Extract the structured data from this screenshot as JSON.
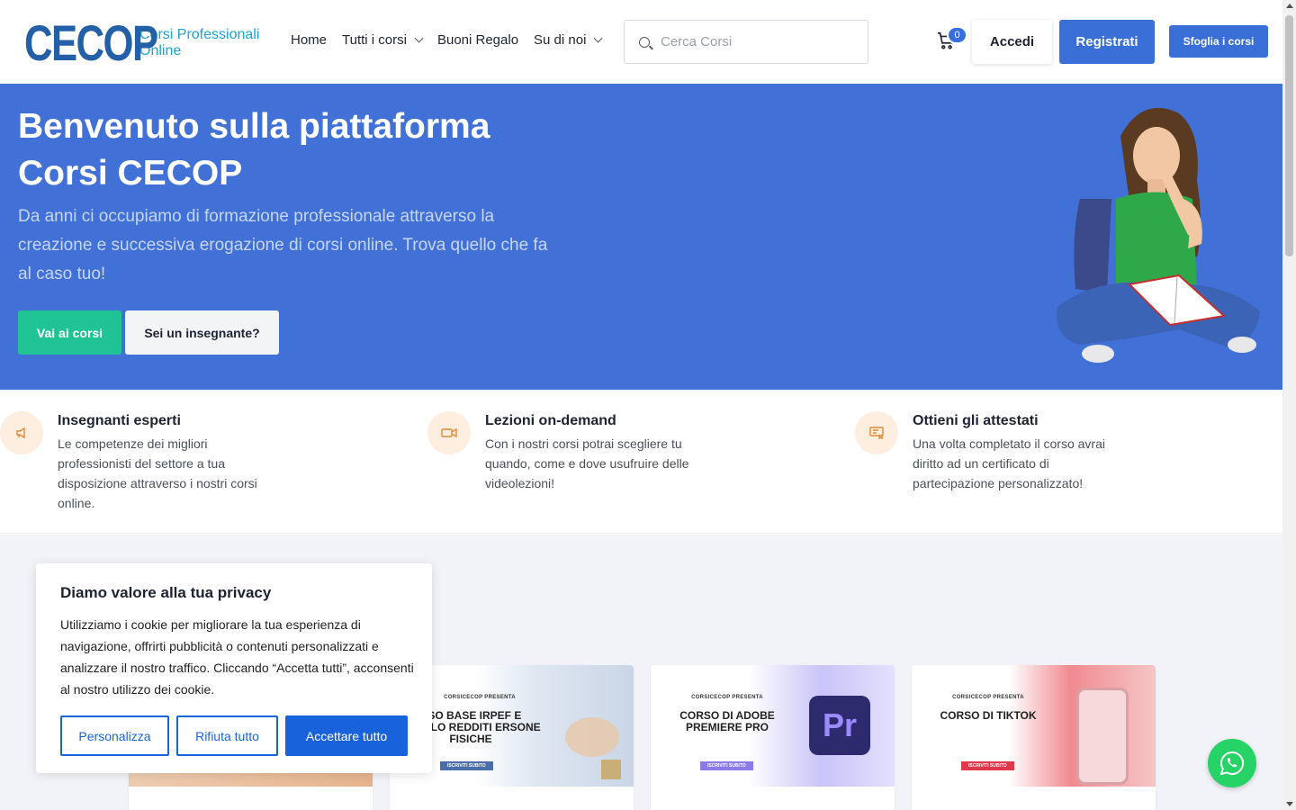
{
  "header": {
    "logo_mark": "CECOP",
    "logo_sub_line1": "Corsi Professionali",
    "logo_sub_line2": "Online",
    "nav": [
      {
        "label": "Home"
      },
      {
        "label": "Tutti i corsi"
      },
      {
        "label": "Buoni Regalo"
      },
      {
        "label": "Su di noi"
      }
    ],
    "search_placeholder": "Cerca Corsi",
    "cart_count": "0",
    "login_label": "Accedi",
    "register_label": "Registrati",
    "browse_label": "Sfoglia i corsi"
  },
  "hero": {
    "title": "Benvenuto sulla piattaforma Corsi CECOP",
    "description": "Da anni ci occupiamo di formazione professionale attraverso la creazione e successiva erogazione di corsi online. Trova quello che fa al caso tuo!",
    "cta_primary": "Vai ai corsi",
    "cta_secondary": "Sei un insegnante?"
  },
  "features": [
    {
      "title": "Insegnanti esperti",
      "text": "Le competenze dei migliori professionisti del settore a tua disposizione attraverso i nostri corsi online.",
      "icon": "megaphone-icon"
    },
    {
      "title": "Lezioni on-demand",
      "text": "Con i nostri corsi potrai scegliere tu quando, come e dove usufruire delle videolezioni!",
      "icon": "video-camera-icon"
    },
    {
      "title": "Ottieni gli attestati",
      "text": "Una volta completato il corso avrai diritto ad un certificato di partecipazione personalizzato!",
      "icon": "certificate-icon"
    }
  ],
  "courses": [
    {
      "brand": "",
      "title": "",
      "cta": "",
      "color": "#f0c9a8"
    },
    {
      "brand": "CORSICECOP PRESENTA",
      "title": "RSO BASE IRPEF E ODELLO REDDITI ERSONE FISICHE",
      "cta": "ISCRIVITI SUBITO",
      "color": "#4a6fa8"
    },
    {
      "brand": "CORSICECOP PRESENTA",
      "title": "CORSO DI ADOBE PREMIERE PRO",
      "cta": "ISCRIVITI SUBITO",
      "color": "#8a7be8"
    },
    {
      "brand": "CORSICECOP PRESENTA",
      "title": "CORSO DI TIKTOK",
      "cta": "ISCRIVITI SUBITO",
      "color": "#e0384a"
    }
  ],
  "premiere_badge": "Pr",
  "cookie": {
    "title": "Diamo valore alla tua privacy",
    "text": "Utilizziamo i cookie per migliorare la tua esperienza di navigazione, offrirti pubblicità o contenuti personalizzati e analizzare il nostro traffico. Cliccando “Accetta tutti”, acconsenti al nostro utilizzo dei cookie.",
    "customize_label": "Personalizza",
    "reject_label": "Rifiuta tutto",
    "accept_label": "Accettare tutto"
  },
  "colors": {
    "brand_blue": "#3a6fd8",
    "hero_bg": "#4171d6",
    "accent_green": "#1fc394",
    "cookie_blue": "#1863dc",
    "whatsapp_green": "#25d366"
  }
}
